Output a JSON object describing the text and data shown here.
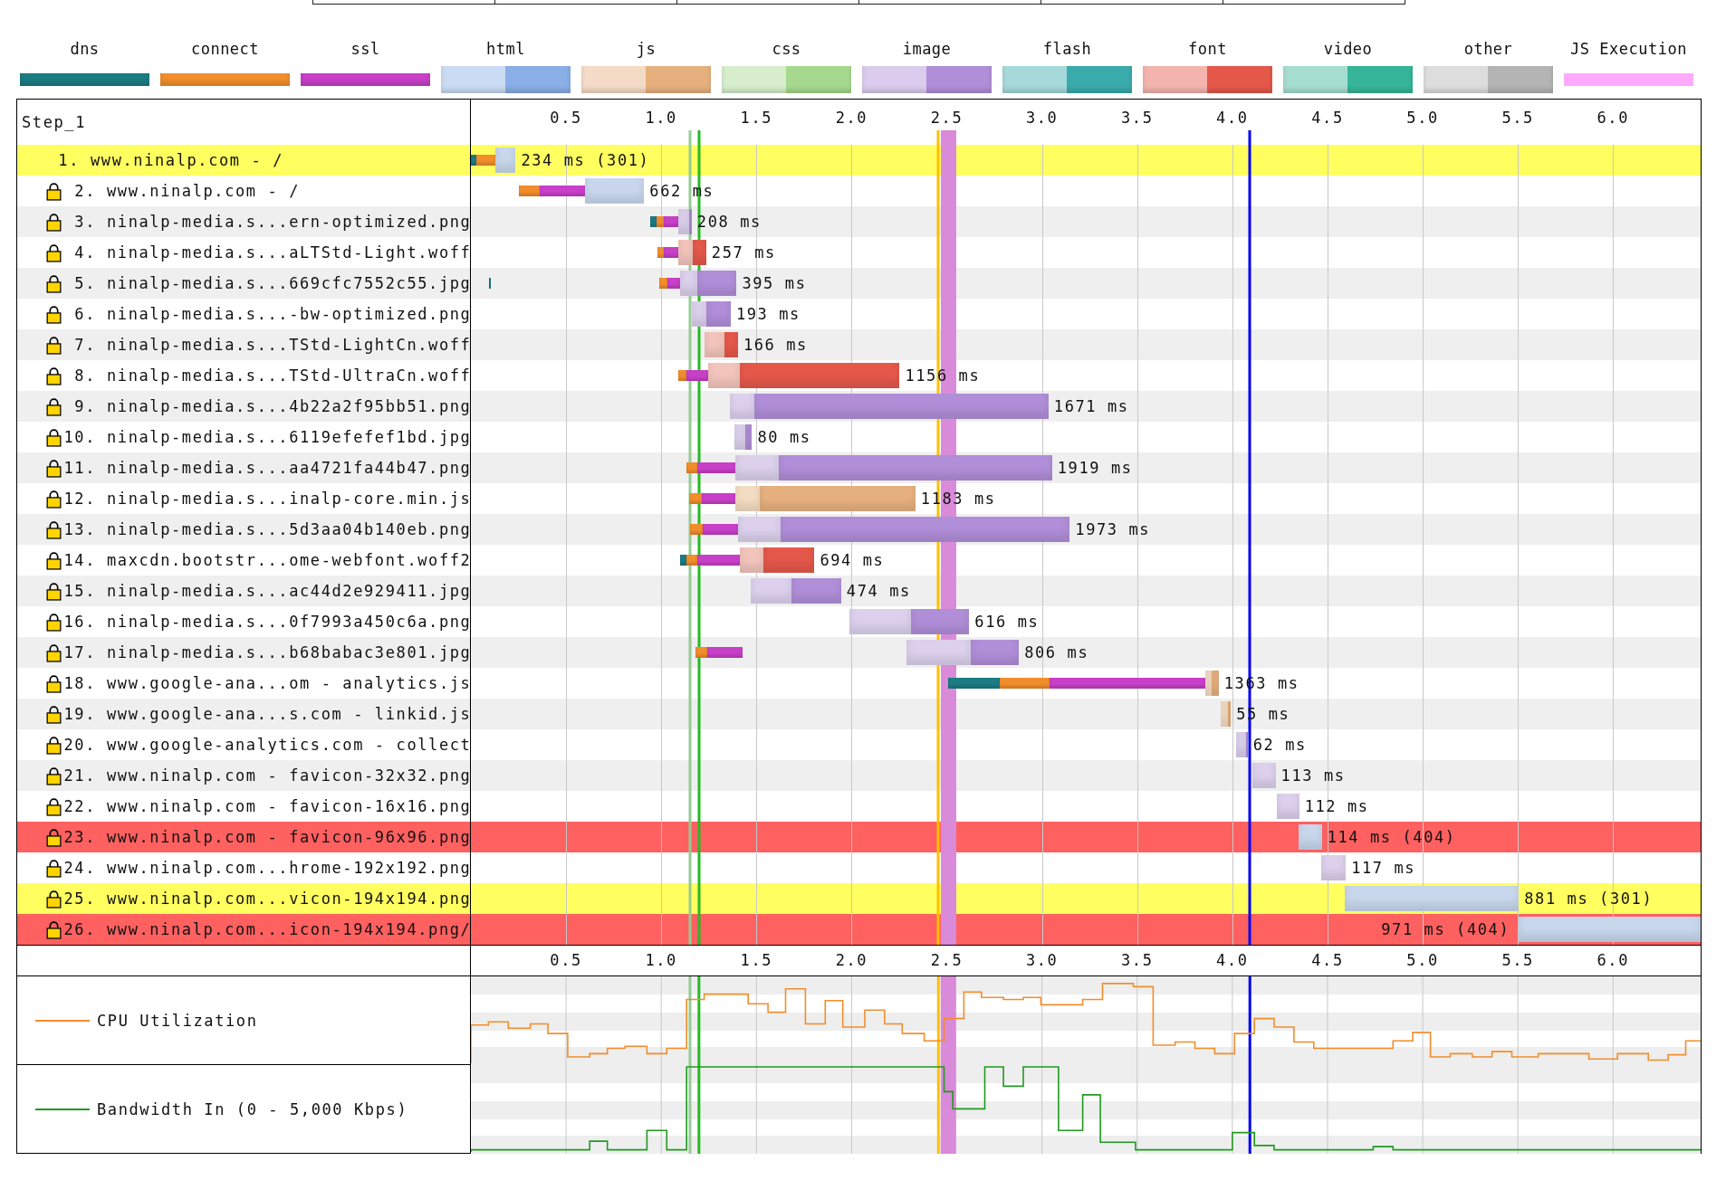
{
  "legend": [
    {
      "label": "dns",
      "kind": "solid",
      "color": "#1b7c83"
    },
    {
      "label": "connect",
      "kind": "solid",
      "color": "#f28d2b"
    },
    {
      "label": "ssl",
      "kind": "solid",
      "color": "#c83fc8"
    },
    {
      "label": "html",
      "kind": "split",
      "color": "#8aaee6"
    },
    {
      "label": "js",
      "kind": "split",
      "color": "#e6b07e"
    },
    {
      "label": "css",
      "kind": "split",
      "color": "#a6d98e"
    },
    {
      "label": "image",
      "kind": "split",
      "color": "#b08ed8"
    },
    {
      "label": "flash",
      "kind": "split",
      "color": "#3aabad"
    },
    {
      "label": "font",
      "kind": "split",
      "color": "#e4584a"
    },
    {
      "label": "video",
      "kind": "split",
      "color": "#36b598"
    },
    {
      "label": "other",
      "kind": "split",
      "color": "#b4b4b4"
    },
    {
      "label": "JS Execution",
      "kind": "thin",
      "color": "#ffaaff"
    }
  ],
  "waterfall": {
    "step_label": "Step_1",
    "top_ticks": [
      "0.5",
      "1.0",
      "1.5",
      "2.0",
      "2.5",
      "3.0",
      "3.5",
      "4.0",
      "4.5",
      "5.0",
      "5.5",
      "6.0"
    ],
    "requests": [
      {
        "number": "1.",
        "label": "www.ninalp.com - /",
        "secure": false,
        "kind": "redirect",
        "timing": "234 ms (301)"
      },
      {
        "number": "2.",
        "label": "www.ninalp.com - /",
        "secure": true,
        "kind": "ok",
        "timing": "662 ms"
      },
      {
        "number": "3.",
        "label": "ninalp-media.s...ern-optimized.png",
        "secure": true,
        "kind": "ok",
        "timing": "208 ms"
      },
      {
        "number": "4.",
        "label": "ninalp-media.s...aLTStd-Light.woff",
        "secure": true,
        "kind": "ok",
        "timing": "257 ms"
      },
      {
        "number": "5.",
        "label": "ninalp-media.s...669cfc7552c55.jpg",
        "secure": true,
        "kind": "ok",
        "timing": "395 ms"
      },
      {
        "number": "6.",
        "label": "ninalp-media.s...-bw-optimized.png",
        "secure": true,
        "kind": "ok",
        "timing": "193 ms"
      },
      {
        "number": "7.",
        "label": "ninalp-media.s...TStd-LightCn.woff",
        "secure": true,
        "kind": "ok",
        "timing": "166 ms"
      },
      {
        "number": "8.",
        "label": "ninalp-media.s...TStd-UltraCn.woff",
        "secure": true,
        "kind": "ok",
        "timing": "1156 ms"
      },
      {
        "number": "9.",
        "label": "ninalp-media.s...4b22a2f95bb51.png",
        "secure": true,
        "kind": "ok",
        "timing": "1671 ms"
      },
      {
        "number": "10.",
        "label": "ninalp-media.s...6119efefef1bd.jpg",
        "secure": true,
        "kind": "ok",
        "timing": "80 ms"
      },
      {
        "number": "11.",
        "label": "ninalp-media.s...aa4721fa44b47.png",
        "secure": true,
        "kind": "ok",
        "timing": "1919 ms"
      },
      {
        "number": "12.",
        "label": "ninalp-media.s...inalp-core.min.js",
        "secure": true,
        "kind": "ok",
        "timing": "1183 ms"
      },
      {
        "number": "13.",
        "label": "ninalp-media.s...5d3aa04b140eb.png",
        "secure": true,
        "kind": "ok",
        "timing": "1973 ms"
      },
      {
        "number": "14.",
        "label": "maxcdn.bootstr...ome-webfont.woff2",
        "secure": true,
        "kind": "ok",
        "timing": "694 ms"
      },
      {
        "number": "15.",
        "label": "ninalp-media.s...ac44d2e929411.jpg",
        "secure": true,
        "kind": "ok",
        "timing": "474 ms"
      },
      {
        "number": "16.",
        "label": "ninalp-media.s...0f7993a450c6a.png",
        "secure": true,
        "kind": "ok",
        "timing": "616 ms"
      },
      {
        "number": "17.",
        "label": "ninalp-media.s...b68babac3e801.jpg",
        "secure": true,
        "kind": "ok",
        "timing": "806 ms"
      },
      {
        "number": "18.",
        "label": "www.google-ana...om - analytics.js",
        "secure": true,
        "kind": "ok",
        "timing": "1363 ms"
      },
      {
        "number": "19.",
        "label": "www.google-ana...s.com - linkid.js",
        "secure": true,
        "kind": "ok",
        "timing": "55 ms"
      },
      {
        "number": "20.",
        "label": "www.google-analytics.com - collect",
        "secure": true,
        "kind": "ok",
        "timing": "62 ms"
      },
      {
        "number": "21.",
        "label": "www.ninalp.com - favicon-32x32.png",
        "secure": true,
        "kind": "ok",
        "timing": "113 ms"
      },
      {
        "number": "22.",
        "label": "www.ninalp.com - favicon-16x16.png",
        "secure": true,
        "kind": "ok",
        "timing": "112 ms"
      },
      {
        "number": "23.",
        "label": "www.ninalp.com - favicon-96x96.png",
        "secure": true,
        "kind": "error",
        "timing": "114 ms (404)"
      },
      {
        "number": "24.",
        "label": "www.ninalp.com...hrome-192x192.png",
        "secure": true,
        "kind": "ok",
        "timing": "117 ms"
      },
      {
        "number": "25.",
        "label": "www.ninalp.com...vicon-194x194.png",
        "secure": true,
        "kind": "redirect",
        "timing": "881 ms (301)"
      },
      {
        "number": "26.",
        "label": "www.ninalp.com...icon-194x194.png/",
        "secure": true,
        "kind": "error",
        "timing": "971 ms (404)"
      }
    ],
    "bottom_ticks": [
      "0.5",
      "1.0",
      "1.5",
      "2.0",
      "2.5",
      "3.0",
      "3.5",
      "4.0",
      "4.5",
      "5.0",
      "5.5",
      "6.0"
    ]
  },
  "graphs": [
    {
      "kind": "cpu",
      "label": "CPU Utilization"
    },
    {
      "kind": "bandwidth",
      "label": "Bandwidth In (0 - 5,000 Kbps)"
    }
  ]
}
